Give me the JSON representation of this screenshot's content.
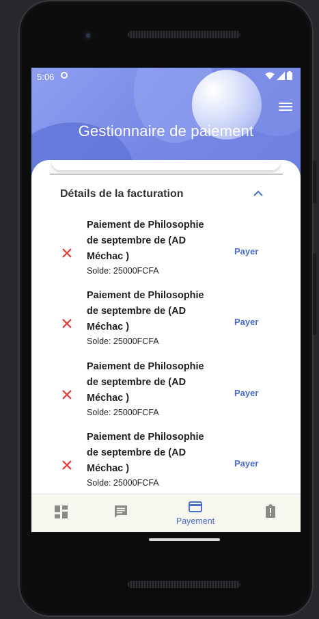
{
  "status_bar": {
    "time": "5:06"
  },
  "header": {
    "title": "Gestionnaire de paiement"
  },
  "billing": {
    "section_title": "Détails de la facturation",
    "items": [
      {
        "line1": "Paiement de Philosophie",
        "line2": "de septembre de (AD",
        "line3": "Méchac )",
        "solde": "Solde: 25000FCFA",
        "action": "Payer"
      },
      {
        "line1": "Paiement de Philosophie",
        "line2": "de septembre de (AD",
        "line3": "Méchac )",
        "solde": "Solde: 25000FCFA",
        "action": "Payer"
      },
      {
        "line1": "Paiement de Philosophie",
        "line2": "de septembre de (AD",
        "line3": "Méchac )",
        "solde": "Solde: 25000FCFA",
        "action": "Payer"
      },
      {
        "line1": "Paiement de Philosophie",
        "line2": "de septembre de (AD",
        "line3": "Méchac )",
        "solde": "Solde: 25000FCFA",
        "action": "Payer"
      }
    ]
  },
  "bottom_nav": {
    "items": [
      {
        "icon": "dashboard-icon",
        "label": ""
      },
      {
        "icon": "chat-icon",
        "label": ""
      },
      {
        "icon": "credit-card-icon",
        "label": "Payement",
        "active": true
      },
      {
        "icon": "report-icon",
        "label": ""
      }
    ]
  },
  "colors": {
    "accent": "#4a6fc9",
    "error": "#e53935",
    "header_start": "#8f9ff0",
    "header_end": "#6f7fe0",
    "nav_background": "#f7f7ef"
  }
}
